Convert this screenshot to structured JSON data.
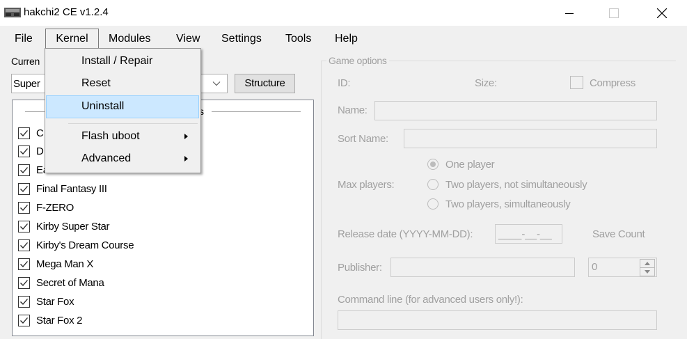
{
  "window": {
    "title": "hakchi2 CE v1.2.4",
    "icons": {
      "app": "hakchi-console-icon",
      "minimize": "minimize-icon",
      "maximize": "maximize-icon",
      "close": "close-icon"
    }
  },
  "menubar": {
    "items": [
      {
        "label": "File"
      },
      {
        "label": "Kernel"
      },
      {
        "label": "Modules"
      },
      {
        "label": "View"
      },
      {
        "label": "Settings"
      },
      {
        "label": "Tools"
      },
      {
        "label": "Help"
      }
    ]
  },
  "kernel_menu": {
    "items": [
      {
        "label": "Install / Repair"
      },
      {
        "label": "Reset"
      },
      {
        "label": "Uninstall"
      },
      {
        "label": "Flash uboot"
      },
      {
        "label": "Advanced"
      }
    ]
  },
  "left": {
    "current_label": "Curren",
    "console_select": "Super",
    "structure_button": "Structure",
    "group_suffix": "s",
    "games": [
      {
        "label": "C"
      },
      {
        "label": "D"
      },
      {
        "label": "EarthBound"
      },
      {
        "label": "Final Fantasy III"
      },
      {
        "label": "F-ZERO"
      },
      {
        "label": "Kirby Super Star"
      },
      {
        "label": "Kirby's Dream Course"
      },
      {
        "label": "Mega Man X"
      },
      {
        "label": "Secret of Mana"
      },
      {
        "label": "Star Fox"
      },
      {
        "label": "Star Fox 2"
      }
    ]
  },
  "game_options": {
    "title": "Game options",
    "id_label": "ID:",
    "size_label": "Size:",
    "compress_label": "Compress",
    "name_label": "Name:",
    "sort_name_label": "Sort Name:",
    "max_players_label": "Max players:",
    "players": [
      {
        "label": "One player"
      },
      {
        "label": "Two players, not simultaneously"
      },
      {
        "label": "Two players, simultaneously"
      }
    ],
    "release_date_label": "Release date (YYYY-MM-DD):",
    "release_date_value": "____-__-__",
    "save_count_label": "Save Count",
    "publisher_label": "Publisher:",
    "save_count_value": "0",
    "command_line_label": "Command line (for advanced users only!):"
  },
  "colors": {
    "highlight": "#cce8ff",
    "highlight_border": "#99d1ff",
    "disabled_text": "#a0a0a0"
  }
}
